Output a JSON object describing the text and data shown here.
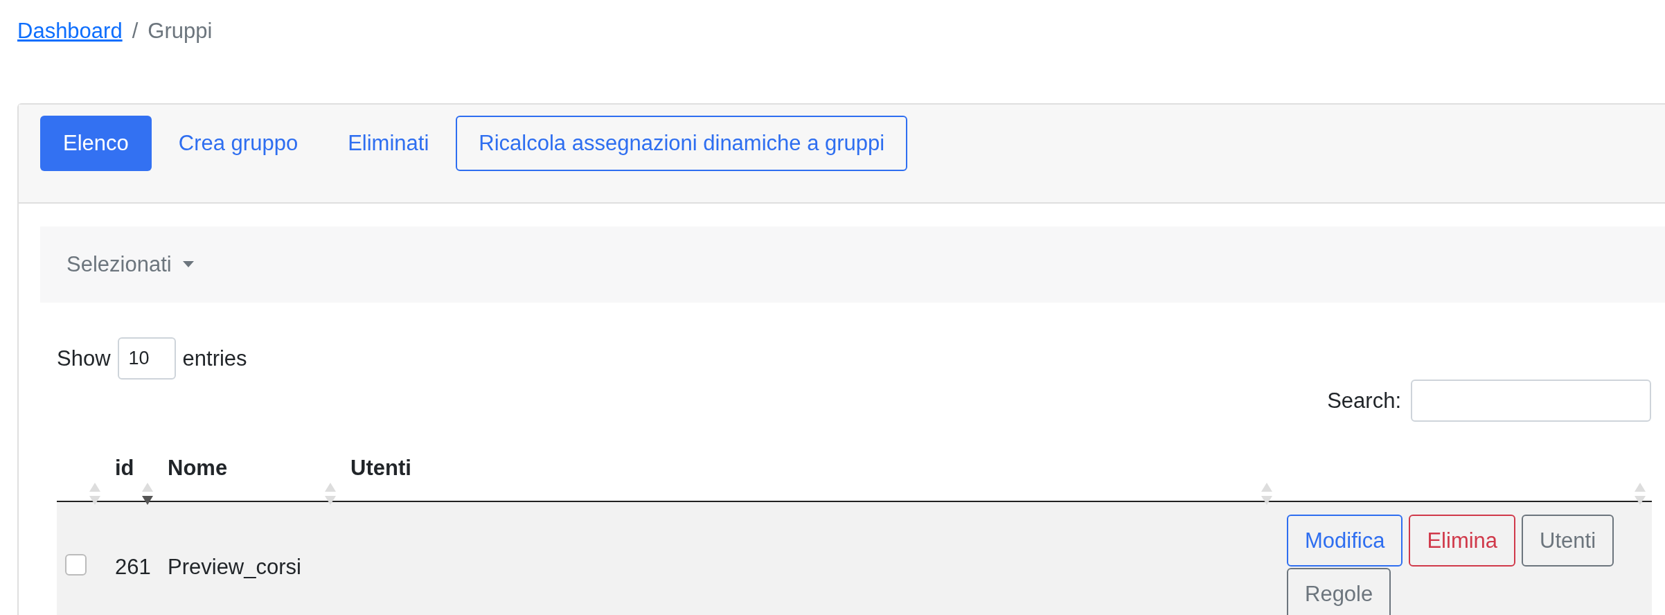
{
  "breadcrumb": {
    "items": [
      {
        "label": "Dashboard",
        "link": true
      },
      {
        "label": "Gruppi",
        "link": false
      }
    ],
    "separator": "/"
  },
  "tabs": [
    {
      "label": "Elenco",
      "selected": true,
      "kind": "pill"
    },
    {
      "label": "Crea gruppo",
      "selected": false,
      "kind": "pill"
    },
    {
      "label": "Eliminati",
      "selected": false,
      "kind": "pill"
    },
    {
      "label": "Ricalcola assegnazioni dinamiche a gruppi",
      "selected": false,
      "kind": "outline"
    }
  ],
  "bulk_menu": {
    "label": "Selezionati"
  },
  "length_menu": {
    "before": "Show",
    "value": "10",
    "after": "entries"
  },
  "search": {
    "label": "Search:"
  },
  "table": {
    "columns": [
      {
        "sorted": false
      },
      {
        "label": "id",
        "sorted": true
      },
      {
        "label": "Nome",
        "sorted": false
      },
      {
        "label": "Utenti",
        "sorted": false
      },
      {
        "sorted": false
      }
    ],
    "rows": [
      {
        "checked": false,
        "id": "261",
        "name": "Preview_corsi",
        "actions": [
          {
            "label": "Modifica",
            "kind": "primary"
          },
          {
            "label": "Elimina",
            "kind": "danger"
          },
          {
            "label": "Utenti",
            "kind": "secondary"
          },
          {
            "label": "Regole",
            "kind": "secondary"
          }
        ]
      }
    ]
  }
}
